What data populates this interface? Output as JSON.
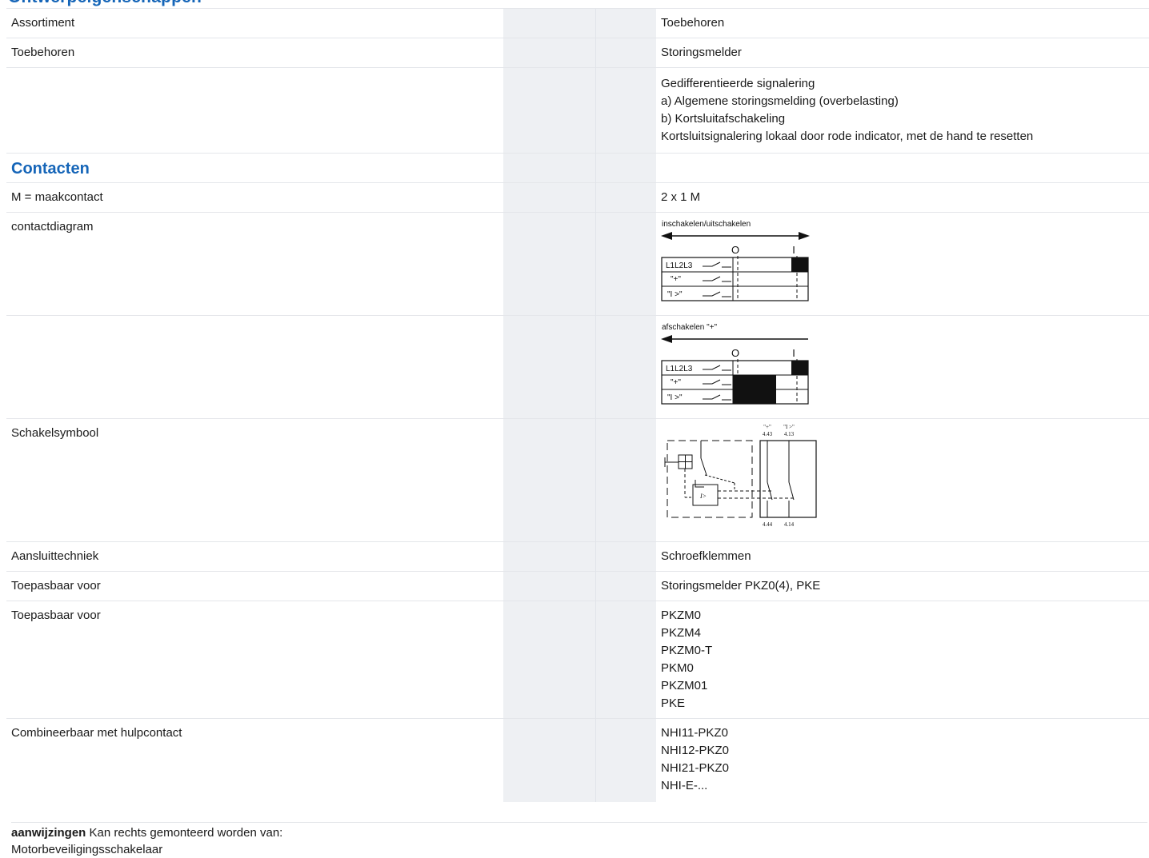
{
  "header": {
    "partial_title": "Ontwerpeigenschappen"
  },
  "rows": {
    "assortiment": {
      "label": "Assortiment",
      "value": "Toebehoren"
    },
    "toebehoren": {
      "label": "Toebehoren",
      "value": "Storingsmelder"
    },
    "beschrijving": {
      "lines": [
        "Gedifferentieerde signalering",
        "a) Algemene storingsmelding (overbelasting)",
        "b) Kortsluitafschakeling",
        "Kortsluitsignalering lokaal door rode indicator, met de hand te resetten"
      ]
    },
    "contacten_section": {
      "label": "Contacten"
    },
    "maakcontact": {
      "label": "M = maakcontact",
      "value": "2 x 1 M"
    },
    "contactdiagram": {
      "label": "contactdiagram"
    },
    "schakelsymbool": {
      "label": "Schakelsymbool"
    },
    "aansluittechniek": {
      "label": "Aansluittechniek",
      "value": "Schroefklemmen"
    },
    "toepasbaar1": {
      "label": "Toepasbaar voor",
      "value": "Storingsmelder PKZ0(4), PKE"
    },
    "toepasbaar2": {
      "label": "Toepasbaar voor",
      "values": [
        "PKZM0",
        "PKZM4",
        "PKZM0-T",
        "PKM0",
        "PKZM01",
        "PKE"
      ]
    },
    "combineerbaar": {
      "label": "Combineerbaar met hulpcontact",
      "values": [
        "NHI11-PKZ0",
        "NHI12-PKZ0",
        "NHI21-PKZ0",
        "NHI-E-..."
      ]
    }
  },
  "diagram1": {
    "caption": "inschakelen/uitschakelen",
    "pos_o": "O",
    "pos_i": "I",
    "rows": [
      "L1L2L3",
      "\"+\"",
      "\"I >\""
    ]
  },
  "diagram2": {
    "caption": "afschakelen \"+\"",
    "pos_o": "O",
    "pos_i": "I",
    "rows": [
      "L1L2L3",
      "\"+\"",
      "\"I >\""
    ]
  },
  "symbol": {
    "top_label_a": "\"+\"",
    "top_label_b": "\"I >\"",
    "top_num_a": "4.43",
    "top_num_b": "4.13",
    "bottom_num_a": "4.44",
    "bottom_num_b": "4.14",
    "inner_label": "I>"
  },
  "notes": {
    "bold_label": "aanwijzingen",
    "text": "Kan rechts gemonteerd worden van:",
    "line2": "Motorbeveiligingsschakelaar"
  }
}
